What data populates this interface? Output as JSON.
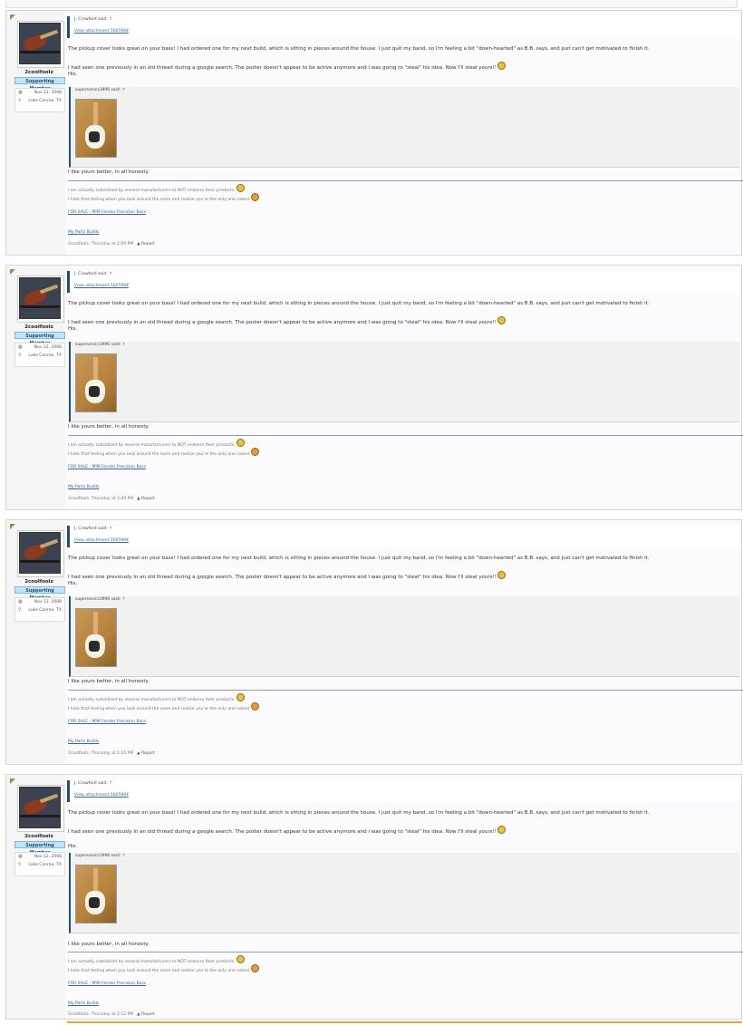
{
  "posts": [
    {
      "username": "2coolfoolz",
      "badge": "Supporting Member",
      "joined": "Nov 12, 2008",
      "location": "Lake Conroe, TX",
      "quote_author": "J. Crawford said:",
      "quote_up": "↑",
      "attachment_link": "View attachment 5005984",
      "message_1": "The pickup cover looks great on your bass! I had ordered one for my next build, which is sitting in pieces around the house. I just quit my band, so I'm feeling a bit \"down-hearted\" as B.B. says, and just can't get motivated to finish it.",
      "message_2": "I had seen one previously in an old thread during a google search. The poster doesn't appear to be active anymore and I was going to \"steal\" his idea. Now I'll steal yours!!",
      "message_3": "His.",
      "subquote_author": "supersonics1996 said:",
      "subquote_up": "↑",
      "reply": "I like yours better, in all honesty.",
      "sig_1": "I am actually subsidized by several manufacturers to NOT endorse their products.",
      "sig_2": "I hate that feeling when you look around the room and realize you're the only one naked.",
      "sig_link_1": "FOR SALE - MIM Fender Precision Bass",
      "sig_link_2": "My Parts Builds",
      "meta": "2coolfoolz, Thursday at 2:09 PM",
      "report": "Report"
    },
    {
      "username": "2coolfoolz",
      "badge": "Supporting Member",
      "joined": "Nov 12, 2008",
      "location": "Lake Conroe, TX",
      "quote_author": "J. Crawford said:",
      "quote_up": "↑",
      "attachment_link": "View attachment 5005984",
      "message_1": "The pickup cover looks great on your bass! I had ordered one for my next build, which is sitting in pieces around the house. I just quit my band, so I'm feeling a bit \"down-hearted\" as B.B. says, and just can't get motivated to finish it.",
      "message_2": "I had seen one previously in an old thread during a google search. The poster doesn't appear to be active anymore and I was going to \"steal\" his idea. Now I'll steal yours!!",
      "message_3": "His.",
      "subquote_author": "supersonics1996 said:",
      "subquote_up": "↑",
      "reply": "I like yours better, in all honesty.",
      "sig_1": "I am actually subsidized by several manufacturers to NOT endorse their products.",
      "sig_2": "I hate that feeling when you look around the room and realize you're the only one naked.",
      "sig_link_1": "FOR SALE - MIM Fender Precision Bass",
      "sig_link_2": "My Parts Builds",
      "meta": "2coolfoolz, Thursday at 2:09 PM",
      "report": "Report"
    },
    {
      "username": "2coolfoolz",
      "badge": "Supporting Member",
      "joined": "Nov 12, 2008",
      "location": "Lake Conroe, TX",
      "quote_author": "J. Crawford said:",
      "quote_up": "↑",
      "attachment_link": "View attachment 5005984",
      "message_1": "The pickup cover looks great on your bass! I had ordered one for my next build, which is sitting in pieces around the house. I just quit my band, so I'm feeling a bit \"down-hearted\" as B.B. says, and just can't get motivated to finish it.",
      "message_2": "I had seen one previously in an old thread during a google search. The poster doesn't appear to be active anymore and I was going to \"steal\" his idea. Now I'll steal yours!!",
      "message_3": "His.",
      "subquote_author": "supersonics1996 said:",
      "subquote_up": "↑",
      "reply": "I like yours better, in all honesty.",
      "sig_1": "I am actually subsidized by several manufacturers to NOT endorse their products.",
      "sig_2": "I hate that feeling when you look around the room and realize you're the only one naked.",
      "sig_link_1": "FOR SALE - MIM Fender Precision Bass",
      "sig_link_2": "My Parts Builds",
      "meta": "2coolfoolz, Thursday at 2:10 PM",
      "report": "Report"
    },
    {
      "username": "2coolfoolz",
      "badge": "Supporting Member",
      "joined": "Nov 12, 2008",
      "location": "Lake Conroe, TX",
      "quote_author": "J. Crawford said:",
      "quote_up": "↑",
      "attachment_link": "View attachment 5005984",
      "message_1": "The pickup cover looks great on your bass! I had ordered one for my next build, which is sitting in pieces around the house. I just quit my band, so I'm feeling a bit \"down-hearted\" as B.B. says, and just can't get motivated to finish it.",
      "message_2": "I had seen one previously in an old thread during a google search. The poster doesn't appear to be active anymore and I was going to \"steal\" his idea. Now I'll steal yours!!",
      "message_3": "His.",
      "subquote_author": "supersonics1996 said:",
      "subquote_up": "↑",
      "reply": "I like yours better, in all honesty.",
      "sig_1": "I am actually subsidized by several manufacturers to NOT endorse their products.",
      "sig_2": "I hate that feeling when you look around the room and realize you're the only one naked.",
      "sig_link_1": "FOR SALE - MIM Fender Precision Bass",
      "sig_link_2": "My Parts Builds",
      "meta": "2coolfoolz, Thursday at 2:12 PM",
      "report": "Report"
    }
  ],
  "icons": {
    "calendar": "calendar-icon",
    "location": "map-pin-icon",
    "report": "warning-icon",
    "smiley_wink": "smiley-icon",
    "smiley_shock": "smiley-shock-icon"
  },
  "colors": {
    "quote_border": "#1f4e79",
    "link": "#3366aa",
    "badge_bg": "#bfe4f5",
    "accent_bar": "#e8a533"
  }
}
